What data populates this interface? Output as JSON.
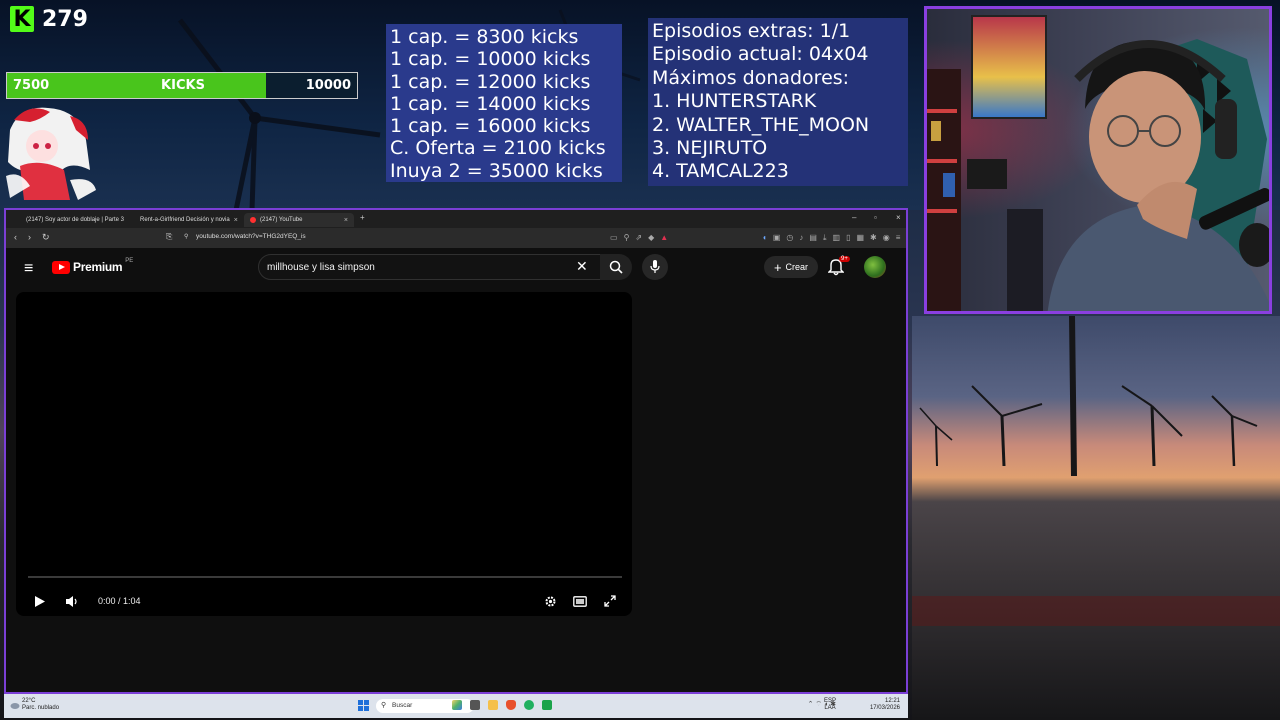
{
  "overlay": {
    "kick_count": "279",
    "kick_logo_letter": "K",
    "goal": {
      "start": "7500",
      "label": "KICKS",
      "end": "10000",
      "progress_fraction": 0.74
    },
    "prices": [
      "1 cap. = 8300 kicks",
      "1 cap. = 10000 kicks",
      "1 cap. = 12000 kicks",
      "1 cap. = 14000 kicks",
      "1 cap. = 16000 kicks",
      "C. Oferta = 2100 kicks",
      "Inuya 2 = 35000 kicks"
    ],
    "info": [
      "Episodios extras: 1/1",
      "Episodio actual: 04x04",
      "Máximos donadores:",
      "1. HUNTERSTARK",
      "2. WALTER_THE_MOON",
      "3. NEJIRUTO",
      "4. TAMCAL223"
    ],
    "accent_color": "#8a3fe0"
  },
  "browser": {
    "tabs": [
      {
        "label": "(2147) Soy actor de doblaje | Parte 3",
        "color": "#ff3030"
      },
      {
        "label": "Rent-a-Girlfriend Decisión y novia",
        "color": "#ff7a1a"
      },
      {
        "label": "(2147) YouTube",
        "color": "#ff3030"
      }
    ],
    "new_tab": "+",
    "url": "youtube.com/watch?v=THG2dYEQ_is"
  },
  "youtube": {
    "brand": "Premium",
    "region": "PE",
    "search_value": "millhouse y lisa simpson",
    "create_label": "Crear",
    "notif_badge": "9+",
    "time_display": "0:00 / 1:04"
  },
  "taskbar": {
    "temperature": "22°C",
    "weather_desc": "Parc. nublado",
    "search_placeholder": "Buscar",
    "lang_top": "ESP",
    "lang_bottom": "LAA",
    "clock_time": "12:21",
    "clock_date": "17/03/2026"
  }
}
